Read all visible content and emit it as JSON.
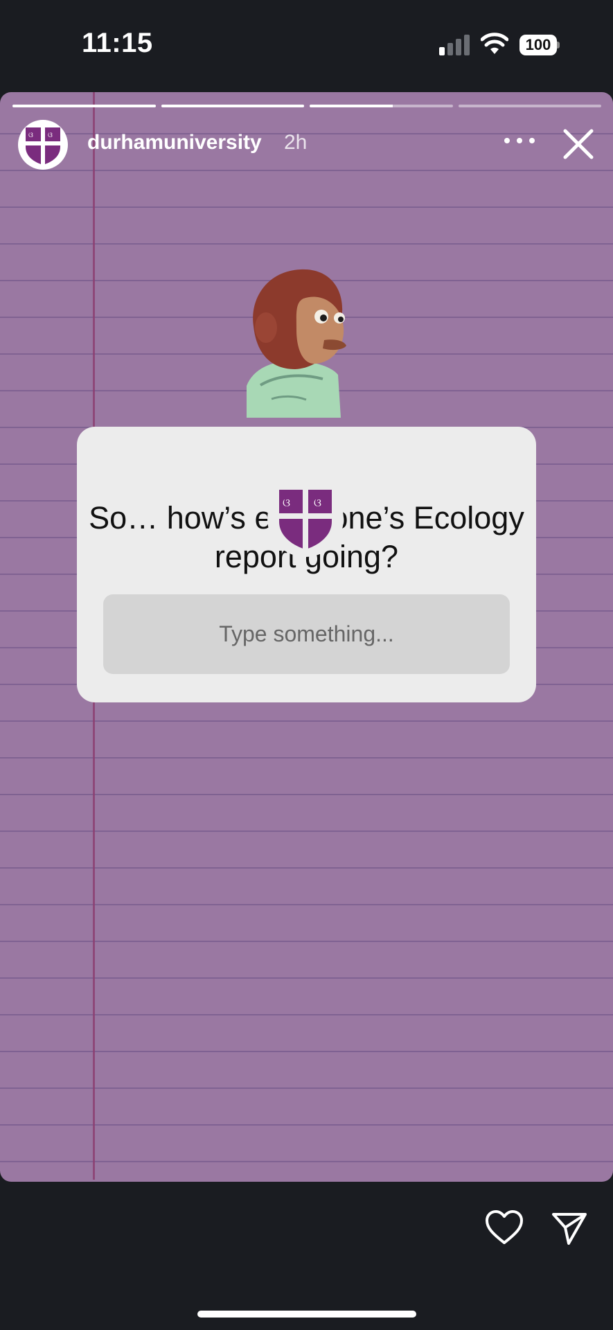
{
  "status_bar": {
    "time": "11:15",
    "battery": "100",
    "signal_bars_active": 1
  },
  "story": {
    "username": "durhamuniversity",
    "time_ago": "2h",
    "progress": [
      1.0,
      1.0,
      0.58,
      0.0
    ]
  },
  "question": {
    "text": "So… how’s everyone’s Ecology report going?",
    "input_placeholder": "Type something..."
  },
  "colors": {
    "background": "#1a1c21",
    "paper": "#9a78a2",
    "paper_lines": "#7b5e8f",
    "margin_line": "#8c3f72",
    "crest_purple": "#7a2c7e",
    "card": "#ececec"
  },
  "icons": {
    "more": "more-icon",
    "close": "close-icon",
    "like": "heart-icon",
    "share": "send-icon"
  }
}
